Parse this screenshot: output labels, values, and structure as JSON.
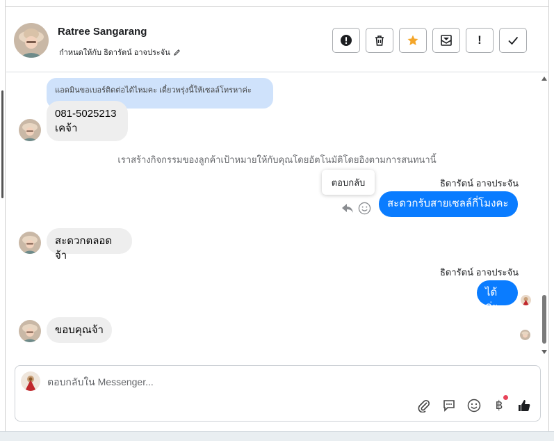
{
  "header": {
    "name": "Ratree Sangarang",
    "assigned_label": "กำหนดให้กับ ธิดารัตน์ อาจประจัน",
    "actions": [
      {
        "icon": "exclamation-circle-icon",
        "label": "!"
      },
      {
        "icon": "trash-icon",
        "label": ""
      },
      {
        "icon": "star-icon",
        "label": ""
      },
      {
        "icon": "mail-move-icon",
        "label": ""
      },
      {
        "icon": "exclamation-icon",
        "label": "!"
      },
      {
        "icon": "check-icon",
        "label": ""
      }
    ]
  },
  "messages": {
    "quoted_text": "แอดมินขอเบอร์ติดต่อได้ไหมคะ เดี๋ยวพรุ่งนี้ให้เซลล์โทรหาค่ะ",
    "phone_line1": "081-5025213",
    "phone_line2": "เคจ้า",
    "system_note": "เราสร้างกิจกรรมของลูกค้าเป้าหมายให้กับคุณโดยอัตโนมัติโดยอิงตามการสนทนานี้",
    "tooltip_reply": "ตอบกลับ",
    "sender_name_1": "ธิดารัตน์ อาจประจัน",
    "out_message_1": "สะดวกรับสายเซลล์กี่โมงคะ",
    "in_message_2": "สะดวกตลอดจ้า",
    "sender_name_2": "ธิดารัตน์ อาจประจัน",
    "out_message_2": "ได้ค่ะ",
    "in_message_3": "ขอบคุณจ้า"
  },
  "composer": {
    "placeholder": "ตอบกลับใน Messenger...",
    "tools": [
      "paperclip-icon",
      "chat-bubble-icon",
      "emoji-icon",
      "baht-icon",
      "thumbs-up-icon"
    ],
    "baht_symbol": "฿"
  },
  "colors": {
    "outgoing_bubble": "#0a7cff",
    "incoming_bubble": "#eeeeee",
    "quoted_bubble": "#cfe2fb",
    "star": "#f4a62a",
    "notification_dot": "#e8445a"
  }
}
